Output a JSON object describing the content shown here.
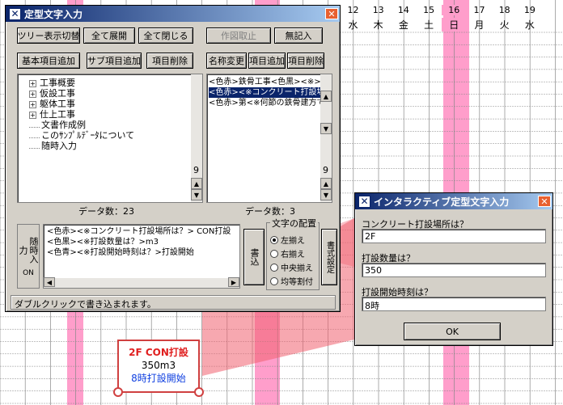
{
  "calendar": {
    "days": [
      {
        "num": "12",
        "dow": "水"
      },
      {
        "num": "13",
        "dow": "木"
      },
      {
        "num": "14",
        "dow": "金"
      },
      {
        "num": "15",
        "dow": "土"
      },
      {
        "num": "16",
        "dow": "日",
        "sunday": true
      },
      {
        "num": "17",
        "dow": "月"
      },
      {
        "num": "18",
        "dow": "火"
      },
      {
        "num": "19",
        "dow": "水"
      }
    ]
  },
  "main_dialog": {
    "title": "定型文字入力",
    "buttons": {
      "tree_toggle": "ツリー表示切替",
      "expand_all": "全て展開",
      "collapse_all": "全て閉じる",
      "cancel_op": "作図取止",
      "no_entry": "無記入",
      "add_basic": "基本項目追加",
      "add_sub": "サブ項目追加",
      "delete_item": "項目削除",
      "rename": "名称変更",
      "add_item": "項目追加",
      "delete_item2": "項目削除",
      "write": "書込",
      "property": "書式設定"
    },
    "tree": [
      "工事概要",
      "仮設工事",
      "躯体工事",
      "仕上工事",
      "文書作成例",
      "このｻﾝﾌﾟﾙﾃﾞｰﾀについて",
      "随時入力"
    ],
    "list": [
      "<色赤>鉄骨工事<色黒><※>①ア",
      "<色赤><※コンクリート打設場所は",
      "<色赤>第<※何節の鉄骨建方ですか"
    ],
    "data_count_left": "データ数：23",
    "data_count_right": "データ数：3",
    "scroll_num_left": "9",
    "scroll_num_right": "9",
    "sidebar_label": "随時入力",
    "sidebar_on": "ON",
    "text_lines": [
      "<色赤><※コンクリート打設場所は？> CON打設",
      "<色黒><※打設数量は？>m3",
      "<色青><※打設開始時刻は？>打設開始"
    ],
    "alignment": {
      "legend": "文字の配置",
      "options": [
        "左揃え",
        "右揃え",
        "中央揃え",
        "均等割付"
      ],
      "selected": 0
    },
    "status": "ダブルクリックで書き込まれます。"
  },
  "interactive_dialog": {
    "title": "インタラクティブ定型文字入力",
    "fields": [
      {
        "label": "コンクリート打設場所は？",
        "value": "2F"
      },
      {
        "label": "打設数量は？",
        "value": "350"
      },
      {
        "label": "打設開始時刻は？",
        "value": "8時"
      }
    ],
    "ok": "OK"
  },
  "annotation": {
    "line1": "2F CON打設",
    "line2": "350m3",
    "line3": "8時打設開始"
  },
  "colors": {
    "pink": "#ff9ecb",
    "title_dark": "#0a246a",
    "callout": "#f06070"
  }
}
